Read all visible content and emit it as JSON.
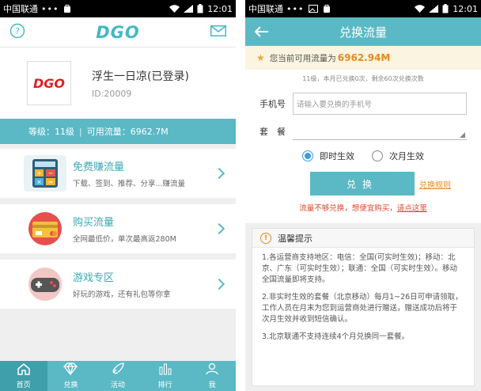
{
  "status": {
    "carrier": "中国联通",
    "dots": "•••",
    "time": "12:01"
  },
  "left": {
    "logo": "DGO",
    "help_icon": "question-circle-icon",
    "mail_icon": "mail-icon",
    "profile": {
      "logo_text": "DGO",
      "username": "浮生一日凉(已登录)",
      "user_id": "ID:20009"
    },
    "infobar": {
      "level": "等级：11级",
      "separator": "|",
      "flow": "可用流量：6962.7M"
    },
    "menu": [
      {
        "title": "免费赚流量",
        "desc": "下载、签到、推荐、分享...赚流量",
        "icon": "calculator-icon"
      },
      {
        "title": "购买流量",
        "desc": "全网最低价，单次最高返280M",
        "icon": "credit-card-icon"
      },
      {
        "title": "游戏专区",
        "desc": "好玩的游戏，还有礼包等你拿",
        "icon": "gamepad-icon"
      }
    ],
    "tabs": [
      {
        "label": "首页",
        "icon": "home-icon"
      },
      {
        "label": "兑换",
        "icon": "diamond-icon"
      },
      {
        "label": "活动",
        "icon": "rocket-icon"
      },
      {
        "label": "排行",
        "icon": "bar-chart-icon"
      },
      {
        "label": "我",
        "icon": "user-icon"
      }
    ]
  },
  "right": {
    "title": "兑换流量",
    "notice_prefix": "您当前可用流量为",
    "notice_value": "6962.94M",
    "subinfo": "11级，本月已兑换0次，剩余60次兑换次数",
    "phone_label": "手机号",
    "phone_placeholder": "请输入要兑换的手机号",
    "package_label": "套　餐",
    "radio_instant": "即时生效",
    "radio_nextmonth": "次月生效",
    "exchange_button": "兑换",
    "rules_link": "兑换规则",
    "low_flow_text": "流量不够兑换，想便宜购买，",
    "low_flow_link": "请点这里",
    "tips_title": "温馨提示",
    "tips": [
      "1.各运营商支持地区：电信：全国(可实时生效)；移动：北京、广东（可实时生效）；联通：全国（可实时生效）。移动全国流量即将支持。",
      "2.非实时生效的套餐（北京移动）每月1~26日可申请领取，工作人员在月末为您到运营商处进行赠送，赠送成功后将于次月生效并收到短信确认。",
      "3.北京联通不支持连续4个月兑换同一套餐。"
    ]
  },
  "colors": {
    "primary": "#5ab9c5",
    "accent": "#e88a1a",
    "red": "#e0452d"
  }
}
